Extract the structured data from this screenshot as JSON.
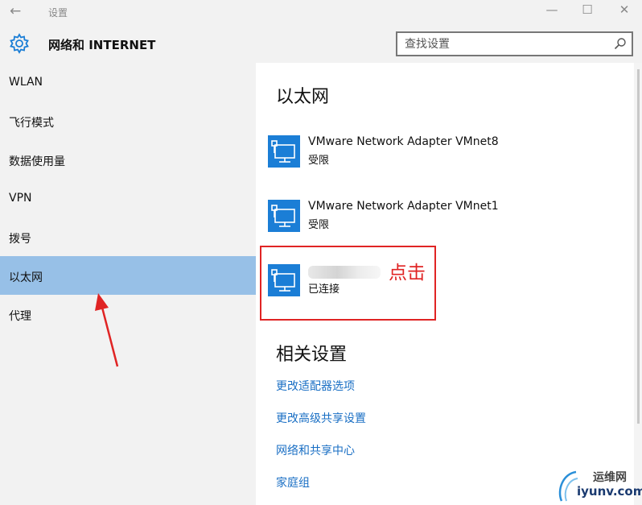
{
  "window": {
    "title": "设置",
    "back_glyph": "←",
    "minimize_glyph": "—",
    "maximize_glyph": "☐",
    "close_glyph": "✕"
  },
  "header": {
    "title": "网络和 INTERNET",
    "search_placeholder": "查找设置",
    "icon": "gear-icon"
  },
  "sidebar": {
    "items": [
      {
        "label": "WLAN"
      },
      {
        "label": "飞行模式"
      },
      {
        "label": "数据使用量"
      },
      {
        "label": "VPN"
      },
      {
        "label": "拨号"
      },
      {
        "label": "以太网",
        "selected": true
      },
      {
        "label": "代理"
      }
    ]
  },
  "main": {
    "section_title": "以太网",
    "adapters": [
      {
        "name": "VMware Network Adapter VMnet8",
        "status": "受限"
      },
      {
        "name": "VMware Network Adapter VMnet1",
        "status": "受限"
      },
      {
        "name": "",
        "status": "已连接",
        "name_redacted": true
      }
    ],
    "annotation": "点击",
    "related_title": "相关设置",
    "related_links": [
      {
        "label": "更改适配器选项"
      },
      {
        "label": "更改高级共享设置"
      },
      {
        "label": "网络和共享中心"
      },
      {
        "label": "家庭组"
      }
    ]
  },
  "watermark": {
    "line1": "运维网",
    "line2": "iyunv.com"
  },
  "colors": {
    "accent": "#1b7ed6",
    "selected": "#97c0e7",
    "annotation": "#e02424",
    "link": "#1a6fc4"
  }
}
